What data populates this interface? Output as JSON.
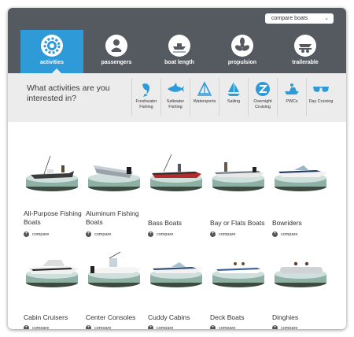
{
  "header": {
    "compare_select": "compare boats"
  },
  "tabs": [
    {
      "label": "activities",
      "icon": "gear-icon"
    },
    {
      "label": "passengers",
      "icon": "passengers-icon"
    },
    {
      "label": "boat length",
      "icon": "boat-length-icon"
    },
    {
      "label": "propulsion",
      "icon": "propeller-icon"
    },
    {
      "label": "trailerable",
      "icon": "trailer-icon"
    }
  ],
  "filter": {
    "question": "What activities are you interested in?",
    "activities": [
      {
        "label": "Freshwater Fishing",
        "icon": "freshwater-fish-icon"
      },
      {
        "label": "Saltwater Fishing",
        "icon": "saltwater-fish-icon"
      },
      {
        "label": "Watersports",
        "icon": "watersports-icon"
      },
      {
        "label": "Sailing",
        "icon": "sailboat-icon"
      },
      {
        "label": "Overnight Cruising",
        "icon": "overnight-cruising-icon"
      },
      {
        "label": "PWCs",
        "icon": "pwc-icon"
      },
      {
        "label": "Day Cruising",
        "icon": "sunglasses-icon"
      }
    ]
  },
  "boats": [
    {
      "name": "All-Purpose Fishing Boats",
      "compare": "compare"
    },
    {
      "name": "Aluminum Fishing Boats",
      "compare": "compare"
    },
    {
      "name": "Bass Boats",
      "compare": "compare"
    },
    {
      "name": "Bay or Flats Boats",
      "compare": "compare"
    },
    {
      "name": "Bowriders",
      "compare": "compare"
    },
    {
      "name": "Cabin Cruisers",
      "compare": "compare"
    },
    {
      "name": "Center Consoles",
      "compare": "compare"
    },
    {
      "name": "Cuddy Cabins",
      "compare": "compare"
    },
    {
      "name": "Deck Boats",
      "compare": "compare"
    },
    {
      "name": "Dinghies",
      "compare": "compare"
    }
  ],
  "colors": {
    "topbar": "#545a60",
    "accent": "#2e9ad8",
    "filterbar": "#ececec"
  }
}
